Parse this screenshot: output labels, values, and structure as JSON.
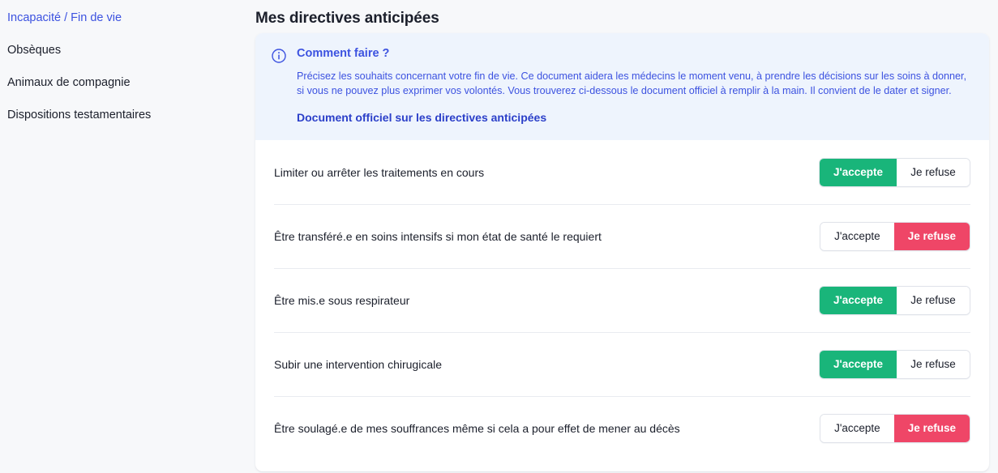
{
  "theme": {
    "page_bg": "#f7f8fa",
    "card_bg": "#ffffff",
    "banner_bg": "#eef4fd",
    "accent_blue": "#3c52e0",
    "link_blue": "#2b3fc9",
    "accept_green": "#19b57a",
    "refuse_red": "#ef4667",
    "text_dark": "#1b1f2b",
    "divider": "#e9ebf0"
  },
  "sidebar": {
    "items": [
      {
        "label": "Incapacité / Fin de vie",
        "active": true
      },
      {
        "label": "Obsèques",
        "active": false
      },
      {
        "label": "Animaux de compagnie",
        "active": false
      },
      {
        "label": "Dispositions testamentaires",
        "active": false
      }
    ]
  },
  "main": {
    "title": "Mes directives anticipées"
  },
  "info_banner": {
    "icon": "info-circle-icon",
    "title": "Comment faire ?",
    "text": "Précisez les souhaits concernant votre fin de vie. Ce document aidera les médecins le moment venu, à prendre les décisions sur les soins à donner, si vous ne pouvez plus exprimer vos volontés. Vous trouverez ci-dessous le document officiel à remplir à la main. Il convient de le dater et signer.",
    "link_label": "Document officiel sur les directives anticipées"
  },
  "choices": {
    "accept_label": "J'accepte",
    "refuse_label": "Je refuse"
  },
  "directives": [
    {
      "label": "Limiter ou arrêter les traitements en cours",
      "selection": "accept"
    },
    {
      "label": "Être transféré.e en soins intensifs si mon état de santé le requiert",
      "selection": "refuse"
    },
    {
      "label": "Être mis.e sous respirateur",
      "selection": "accept"
    },
    {
      "label": "Subir une intervention chirugicale",
      "selection": "accept"
    },
    {
      "label": "Être soulagé.e de mes souffrances même si cela a pour effet de mener au décès",
      "selection": "refuse"
    }
  ]
}
